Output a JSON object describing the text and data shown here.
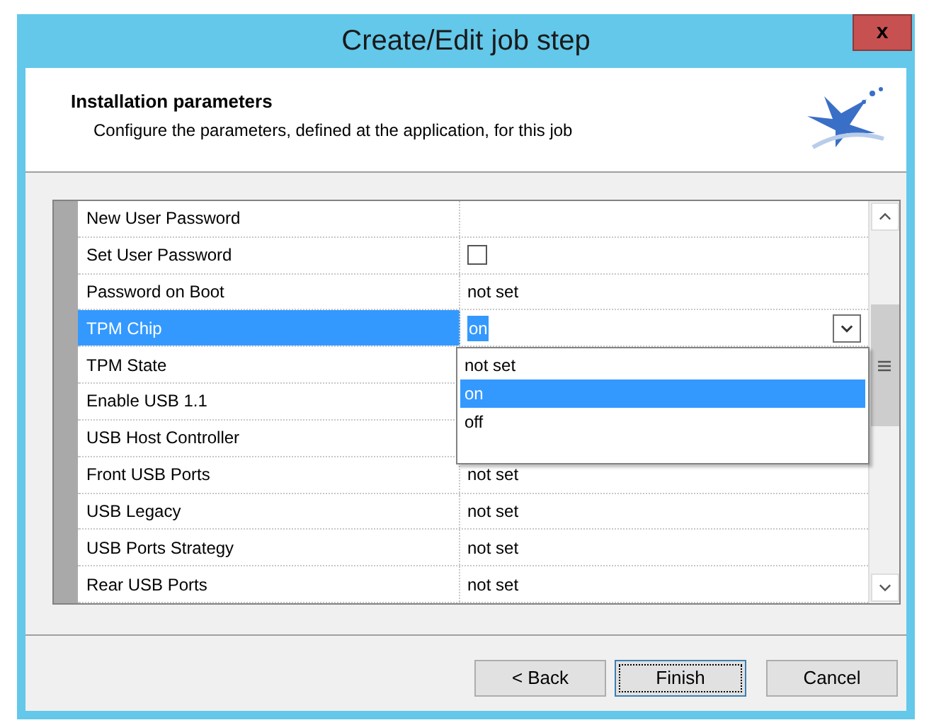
{
  "window": {
    "title": "Create/Edit job step",
    "close": "x"
  },
  "header": {
    "title": "Installation parameters",
    "subtitle": "Configure the parameters, defined at the application, for this job"
  },
  "grid": {
    "rows": [
      {
        "name": "New User Password",
        "kind": "text",
        "value": "",
        "selected": false
      },
      {
        "name": "Set User Password",
        "kind": "checkbox",
        "checked": false,
        "selected": false
      },
      {
        "name": "Password on Boot",
        "kind": "text",
        "value": "not set",
        "selected": false
      },
      {
        "name": "TPM Chip",
        "kind": "combo",
        "value": "on",
        "selected": true
      },
      {
        "name": "TPM State",
        "kind": "text",
        "value": "",
        "selected": false
      },
      {
        "name": "Enable USB 1.1",
        "kind": "text",
        "value": "",
        "selected": false
      },
      {
        "name": "USB Host Controller",
        "kind": "text",
        "value": "",
        "selected": false
      },
      {
        "name": "Front USB Ports",
        "kind": "text",
        "value": "not set",
        "selected": false
      },
      {
        "name": "USB Legacy",
        "kind": "text",
        "value": "not set",
        "selected": false
      },
      {
        "name": "USB Ports Strategy",
        "kind": "text",
        "value": "not set",
        "selected": false
      },
      {
        "name": "Rear USB Ports",
        "kind": "text",
        "value": "not set",
        "selected": false
      }
    ],
    "dropdown": {
      "options": [
        {
          "label": "not set",
          "selected": false
        },
        {
          "label": "on",
          "selected": true
        },
        {
          "label": "off",
          "selected": false
        }
      ]
    }
  },
  "buttons": [
    {
      "label": "< Back",
      "focused": false
    },
    {
      "label": "Finish",
      "focused": true
    },
    {
      "label": "Cancel",
      "focused": false
    }
  ]
}
